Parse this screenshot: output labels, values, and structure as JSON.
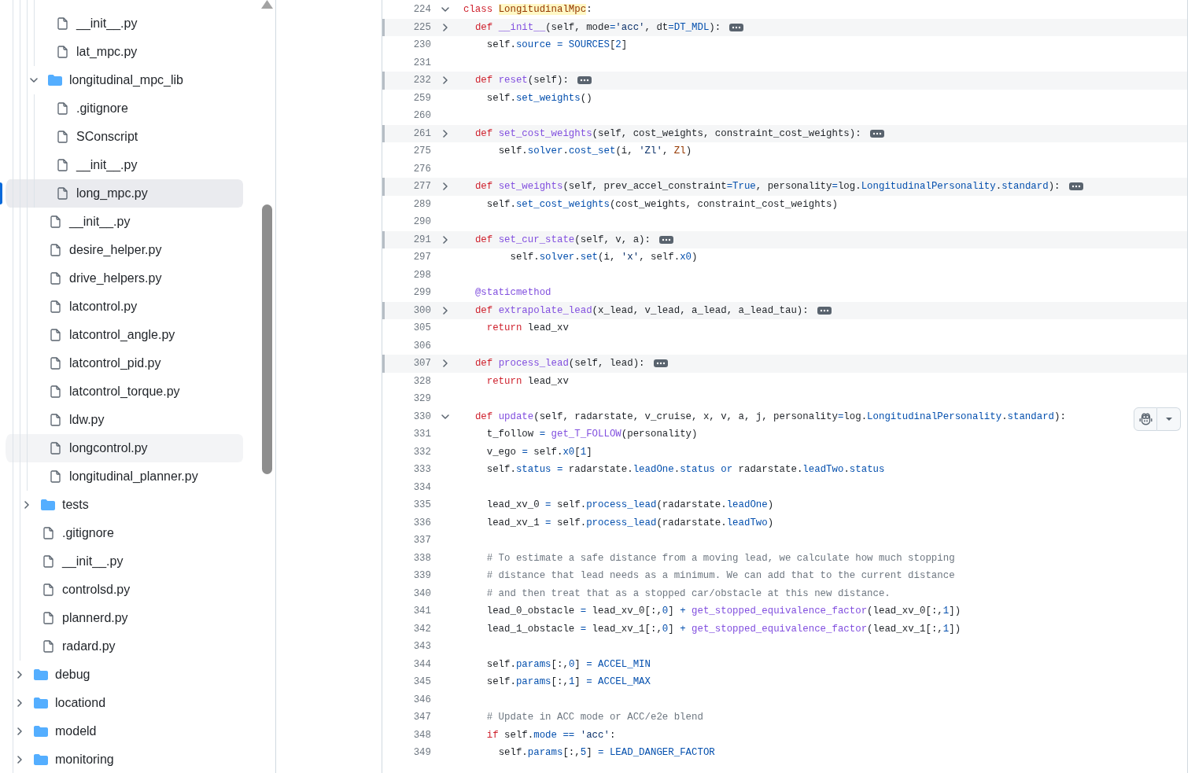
{
  "file_tree": {
    "items": [
      {
        "children": [
          {
            "children": [
              {
                "children": [
                  {
                    "kind": "file",
                    "name": "__init__.py",
                    "selected": false,
                    "hovered": false
                  },
                  {
                    "kind": "file",
                    "name": "lat_mpc.py",
                    "selected": false,
                    "hovered": false
                  }
                ]
              },
              {
                "kind": "folder",
                "name": "longitudinal_mpc_lib",
                "expanded": true,
                "selected": false,
                "hovered": false,
                "children": [
                  {
                    "kind": "file",
                    "name": ".gitignore",
                    "selected": false,
                    "hovered": false
                  },
                  {
                    "kind": "file",
                    "name": "SConscript",
                    "selected": false,
                    "hovered": false
                  },
                  {
                    "kind": "file",
                    "name": "__init__.py",
                    "selected": false,
                    "hovered": false
                  },
                  {
                    "kind": "file",
                    "name": "long_mpc.py",
                    "selected": true,
                    "hovered": false
                  }
                ]
              },
              {
                "kind": "file",
                "name": "__init__.py",
                "selected": false,
                "hovered": false
              },
              {
                "kind": "file",
                "name": "desire_helper.py",
                "selected": false,
                "hovered": false
              },
              {
                "kind": "file",
                "name": "drive_helpers.py",
                "selected": false,
                "hovered": false
              },
              {
                "kind": "file",
                "name": "latcontrol.py",
                "selected": false,
                "hovered": false
              },
              {
                "kind": "file",
                "name": "latcontrol_angle.py",
                "selected": false,
                "hovered": false
              },
              {
                "kind": "file",
                "name": "latcontrol_pid.py",
                "selected": false,
                "hovered": false
              },
              {
                "kind": "file",
                "name": "latcontrol_torque.py",
                "selected": false,
                "hovered": false
              },
              {
                "kind": "file",
                "name": "ldw.py",
                "selected": false,
                "hovered": false
              },
              {
                "kind": "file",
                "name": "longcontrol.py",
                "selected": false,
                "hovered": true
              },
              {
                "kind": "file",
                "name": "longitudinal_planner.py",
                "selected": false,
                "hovered": false
              }
            ]
          },
          {
            "kind": "folder",
            "name": "tests",
            "expanded": false,
            "selected": false,
            "hovered": false
          },
          {
            "kind": "file",
            "name": ".gitignore",
            "selected": false,
            "hovered": false
          },
          {
            "kind": "file",
            "name": "__init__.py",
            "selected": false,
            "hovered": false
          },
          {
            "kind": "file",
            "name": "controlsd.py",
            "selected": false,
            "hovered": false
          },
          {
            "kind": "file",
            "name": "plannerd.py",
            "selected": false,
            "hovered": false
          },
          {
            "kind": "file",
            "name": "radard.py",
            "selected": false,
            "hovered": false
          }
        ]
      },
      {
        "kind": "folder",
        "name": "debug",
        "expanded": false,
        "selected": false,
        "hovered": false
      },
      {
        "kind": "folder",
        "name": "locationd",
        "expanded": false,
        "selected": false,
        "hovered": false
      },
      {
        "kind": "folder",
        "name": "modeld",
        "expanded": false,
        "selected": false,
        "hovered": false
      },
      {
        "kind": "folder",
        "name": "monitoring",
        "expanded": false,
        "selected": false,
        "hovered": false
      }
    ]
  },
  "code_view": {
    "lines": [
      {
        "number": "224",
        "kind": "fold",
        "expanded": true,
        "tokens": [
          {
            "text": "class ",
            "kind": "keyword"
          },
          {
            "text": "LongitudinalMpc",
            "kind": "match"
          },
          {
            "text": ":",
            "kind": "plain"
          }
        ]
      },
      {
        "number": "225",
        "kind": "fold",
        "expanded": false,
        "tokens": [
          {
            "text": "  def ",
            "kind": "keyword"
          },
          {
            "text": "__init__",
            "kind": "function"
          },
          {
            "text": "(self, mode",
            "kind": "plain"
          },
          {
            "text": "=",
            "kind": "constant"
          },
          {
            "text": "'acc'",
            "kind": "string"
          },
          {
            "text": ", dt",
            "kind": "plain"
          },
          {
            "text": "=DT_MDL",
            "kind": "constant"
          },
          {
            "text": "):",
            "kind": "plain"
          }
        ]
      },
      {
        "number": "230",
        "kind": "code",
        "tokens": [
          {
            "text": "    self.",
            "kind": "plain"
          },
          {
            "text": "source = SOURCES",
            "kind": "constant"
          },
          {
            "text": "[",
            "kind": "plain"
          },
          {
            "text": "2",
            "kind": "constant"
          },
          {
            "text": "]",
            "kind": "plain"
          }
        ]
      },
      {
        "number": "231",
        "kind": "code"
      },
      {
        "number": "232",
        "kind": "fold",
        "expanded": false,
        "tokens": [
          {
            "text": "  def ",
            "kind": "keyword"
          },
          {
            "text": "reset",
            "kind": "function"
          },
          {
            "text": "(self):",
            "kind": "plain"
          }
        ]
      },
      {
        "number": "259",
        "kind": "code",
        "tokens": [
          {
            "text": "    self.",
            "kind": "plain"
          },
          {
            "text": "set_weights",
            "kind": "constant"
          },
          {
            "text": "()",
            "kind": "plain"
          }
        ]
      },
      {
        "number": "260",
        "kind": "code"
      },
      {
        "number": "261",
        "kind": "fold",
        "expanded": false,
        "tokens": [
          {
            "text": "  def ",
            "kind": "keyword"
          },
          {
            "text": "set_cost_weights",
            "kind": "function"
          },
          {
            "text": "(self, cost_weights, constraint_cost_weights):",
            "kind": "plain"
          }
        ]
      },
      {
        "number": "275",
        "kind": "code",
        "tokens": [
          {
            "text": "      self.",
            "kind": "plain"
          },
          {
            "text": "solver",
            "kind": "constant"
          },
          {
            "text": ".",
            "kind": "plain"
          },
          {
            "text": "cost_set",
            "kind": "constant"
          },
          {
            "text": "(i, ",
            "kind": "plain"
          },
          {
            "text": "'Zl'",
            "kind": "string"
          },
          {
            "text": ", ",
            "kind": "plain"
          },
          {
            "text": "Zl",
            "kind": "variable"
          },
          {
            "text": ")",
            "kind": "plain"
          }
        ]
      },
      {
        "number": "276",
        "kind": "code"
      },
      {
        "number": "277",
        "kind": "fold",
        "expanded": false,
        "tokens": [
          {
            "text": "  def ",
            "kind": "keyword"
          },
          {
            "text": "set_weights",
            "kind": "function"
          },
          {
            "text": "(self, prev_accel_constraint",
            "kind": "plain"
          },
          {
            "text": "=True",
            "kind": "constant"
          },
          {
            "text": ", personality",
            "kind": "plain"
          },
          {
            "text": "=",
            "kind": "constant"
          },
          {
            "text": "log.",
            "kind": "plain"
          },
          {
            "text": "LongitudinalPersonality",
            "kind": "constant"
          },
          {
            "text": ".",
            "kind": "plain"
          },
          {
            "text": "standard",
            "kind": "constant"
          },
          {
            "text": "):",
            "kind": "plain"
          }
        ]
      },
      {
        "number": "289",
        "kind": "code",
        "tokens": [
          {
            "text": "    self.",
            "kind": "plain"
          },
          {
            "text": "set_cost_weights",
            "kind": "constant"
          },
          {
            "text": "(cost_weights, constraint_cost_weights)",
            "kind": "plain"
          }
        ]
      },
      {
        "number": "290",
        "kind": "code"
      },
      {
        "number": "291",
        "kind": "fold",
        "expanded": false,
        "tokens": [
          {
            "text": "  def ",
            "kind": "keyword"
          },
          {
            "text": "set_cur_state",
            "kind": "function"
          },
          {
            "text": "(self, v, a):",
            "kind": "plain"
          }
        ]
      },
      {
        "number": "297",
        "kind": "code",
        "tokens": [
          {
            "text": "        self.",
            "kind": "plain"
          },
          {
            "text": "solver",
            "kind": "constant"
          },
          {
            "text": ".",
            "kind": "plain"
          },
          {
            "text": "set",
            "kind": "constant"
          },
          {
            "text": "(i, ",
            "kind": "plain"
          },
          {
            "text": "'x'",
            "kind": "string"
          },
          {
            "text": ", self.",
            "kind": "plain"
          },
          {
            "text": "x0",
            "kind": "constant"
          },
          {
            "text": ")",
            "kind": "plain"
          }
        ]
      },
      {
        "number": "298",
        "kind": "code"
      },
      {
        "number": "299",
        "kind": "code",
        "tokens": [
          {
            "text": "  @staticmethod",
            "kind": "function"
          }
        ]
      },
      {
        "number": "300",
        "kind": "fold",
        "expanded": false,
        "tokens": [
          {
            "text": "  def ",
            "kind": "keyword"
          },
          {
            "text": "extrapolate_lead",
            "kind": "function"
          },
          {
            "text": "(x_lead, v_lead, a_lead, a_lead_tau):",
            "kind": "plain"
          }
        ]
      },
      {
        "number": "305",
        "kind": "code",
        "tokens": [
          {
            "text": "    return",
            "kind": "keyword"
          },
          {
            "text": " lead_xv",
            "kind": "plain"
          }
        ]
      },
      {
        "number": "306",
        "kind": "code"
      },
      {
        "number": "307",
        "kind": "fold",
        "expanded": false,
        "tokens": [
          {
            "text": "  def ",
            "kind": "keyword"
          },
          {
            "text": "process_lead",
            "kind": "function"
          },
          {
            "text": "(self, lead):",
            "kind": "plain"
          }
        ]
      },
      {
        "number": "328",
        "kind": "code",
        "tokens": [
          {
            "text": "    return",
            "kind": "keyword"
          },
          {
            "text": " lead_xv",
            "kind": "plain"
          }
        ]
      },
      {
        "number": "329",
        "kind": "code"
      },
      {
        "number": "330",
        "kind": "fold",
        "expanded": true,
        "tokens": [
          {
            "text": "  def ",
            "kind": "keyword"
          },
          {
            "text": "update",
            "kind": "function"
          },
          {
            "text": "(self, radarstate, v_cruise, x, v, a, j, personality",
            "kind": "plain"
          },
          {
            "text": "=",
            "kind": "constant"
          },
          {
            "text": "log.",
            "kind": "plain"
          },
          {
            "text": "LongitudinalPersonality",
            "kind": "constant"
          },
          {
            "text": ".",
            "kind": "plain"
          },
          {
            "text": "standard",
            "kind": "constant"
          },
          {
            "text": "):",
            "kind": "plain"
          }
        ]
      },
      {
        "number": "331",
        "kind": "code",
        "tokens": [
          {
            "text": "    t_follow ",
            "kind": "plain"
          },
          {
            "text": "= ",
            "kind": "constant"
          },
          {
            "text": "get_T_FOLLOW",
            "kind": "function"
          },
          {
            "text": "(personality)",
            "kind": "plain"
          }
        ]
      },
      {
        "number": "332",
        "kind": "code",
        "tokens": [
          {
            "text": "    v_ego ",
            "kind": "plain"
          },
          {
            "text": "=",
            "kind": "constant"
          },
          {
            "text": " self.",
            "kind": "plain"
          },
          {
            "text": "x0",
            "kind": "constant"
          },
          {
            "text": "[",
            "kind": "plain"
          },
          {
            "text": "1",
            "kind": "constant"
          },
          {
            "text": "]",
            "kind": "plain"
          }
        ]
      },
      {
        "number": "333",
        "kind": "code",
        "tokens": [
          {
            "text": "    self.",
            "kind": "plain"
          },
          {
            "text": "status =",
            "kind": "constant"
          },
          {
            "text": " radarstate.",
            "kind": "plain"
          },
          {
            "text": "leadOne",
            "kind": "constant"
          },
          {
            "text": ".",
            "kind": "plain"
          },
          {
            "text": "status or",
            "kind": "constant"
          },
          {
            "text": " radarstate.",
            "kind": "plain"
          },
          {
            "text": "leadTwo",
            "kind": "constant"
          },
          {
            "text": ".",
            "kind": "plain"
          },
          {
            "text": "status",
            "kind": "constant"
          }
        ]
      },
      {
        "number": "334",
        "kind": "code"
      },
      {
        "number": "335",
        "kind": "code",
        "tokens": [
          {
            "text": "    lead_xv_0 ",
            "kind": "plain"
          },
          {
            "text": "=",
            "kind": "constant"
          },
          {
            "text": " self.",
            "kind": "plain"
          },
          {
            "text": "process_lead",
            "kind": "constant"
          },
          {
            "text": "(radarstate.",
            "kind": "plain"
          },
          {
            "text": "leadOne",
            "kind": "constant"
          },
          {
            "text": ")",
            "kind": "plain"
          }
        ]
      },
      {
        "number": "336",
        "kind": "code",
        "tokens": [
          {
            "text": "    lead_xv_1 ",
            "kind": "plain"
          },
          {
            "text": "=",
            "kind": "constant"
          },
          {
            "text": " self.",
            "kind": "plain"
          },
          {
            "text": "process_lead",
            "kind": "constant"
          },
          {
            "text": "(radarstate.",
            "kind": "plain"
          },
          {
            "text": "leadTwo",
            "kind": "constant"
          },
          {
            "text": ")",
            "kind": "plain"
          }
        ]
      },
      {
        "number": "337",
        "kind": "code"
      },
      {
        "number": "338",
        "kind": "code",
        "tokens": [
          {
            "text": "    # To estimate a safe distance from a moving lead, we calculate how much stopping",
            "kind": "comment"
          }
        ]
      },
      {
        "number": "339",
        "kind": "code",
        "tokens": [
          {
            "text": "    # distance that lead needs as a minimum. We can add that to the current distance",
            "kind": "comment"
          }
        ]
      },
      {
        "number": "340",
        "kind": "code",
        "tokens": [
          {
            "text": "    # and then treat that as a stopped car/obstacle at this new distance.",
            "kind": "comment"
          }
        ]
      },
      {
        "number": "341",
        "kind": "code",
        "tokens": [
          {
            "text": "    lead_0_obstacle ",
            "kind": "plain"
          },
          {
            "text": "=",
            "kind": "constant"
          },
          {
            "text": " lead_xv_0[:,",
            "kind": "plain"
          },
          {
            "text": "0",
            "kind": "constant"
          },
          {
            "text": "] ",
            "kind": "plain"
          },
          {
            "text": "+ ",
            "kind": "constant"
          },
          {
            "text": "get_stopped_equivalence_factor",
            "kind": "function"
          },
          {
            "text": "(lead_xv_0[:,",
            "kind": "plain"
          },
          {
            "text": "1",
            "kind": "constant"
          },
          {
            "text": "])",
            "kind": "plain"
          }
        ]
      },
      {
        "number": "342",
        "kind": "code",
        "tokens": [
          {
            "text": "    lead_1_obstacle ",
            "kind": "plain"
          },
          {
            "text": "=",
            "kind": "constant"
          },
          {
            "text": " lead_xv_1[:,",
            "kind": "plain"
          },
          {
            "text": "0",
            "kind": "constant"
          },
          {
            "text": "] ",
            "kind": "plain"
          },
          {
            "text": "+ ",
            "kind": "constant"
          },
          {
            "text": "get_stopped_equivalence_factor",
            "kind": "function"
          },
          {
            "text": "(lead_xv_1[:,",
            "kind": "plain"
          },
          {
            "text": "1",
            "kind": "constant"
          },
          {
            "text": "])",
            "kind": "plain"
          }
        ]
      },
      {
        "number": "343",
        "kind": "code"
      },
      {
        "number": "344",
        "kind": "code",
        "tokens": [
          {
            "text": "    self.",
            "kind": "plain"
          },
          {
            "text": "params",
            "kind": "constant"
          },
          {
            "text": "[:,",
            "kind": "plain"
          },
          {
            "text": "0",
            "kind": "constant"
          },
          {
            "text": "] ",
            "kind": "plain"
          },
          {
            "text": "= ACCEL_MIN",
            "kind": "constant"
          }
        ]
      },
      {
        "number": "345",
        "kind": "code",
        "tokens": [
          {
            "text": "    self.",
            "kind": "plain"
          },
          {
            "text": "params",
            "kind": "constant"
          },
          {
            "text": "[:,",
            "kind": "plain"
          },
          {
            "text": "1",
            "kind": "constant"
          },
          {
            "text": "] ",
            "kind": "plain"
          },
          {
            "text": "= ACCEL_MAX",
            "kind": "constant"
          }
        ]
      },
      {
        "number": "346",
        "kind": "code"
      },
      {
        "number": "347",
        "kind": "code",
        "tokens": [
          {
            "text": "    # Update in ACC mode or ACC/e2e blend",
            "kind": "comment"
          }
        ]
      },
      {
        "number": "348",
        "kind": "code",
        "tokens": [
          {
            "text": "    if",
            "kind": "keyword"
          },
          {
            "text": " self.",
            "kind": "plain"
          },
          {
            "text": "mode ==",
            "kind": "constant"
          },
          {
            "text": " 'acc'",
            "kind": "string"
          },
          {
            "text": ":",
            "kind": "plain"
          }
        ]
      },
      {
        "number": "349",
        "kind": "code",
        "tokens": [
          {
            "text": "      self.",
            "kind": "plain"
          },
          {
            "text": "params",
            "kind": "constant"
          },
          {
            "text": "[:,",
            "kind": "plain"
          },
          {
            "text": "5",
            "kind": "constant"
          },
          {
            "text": "] ",
            "kind": "plain"
          },
          {
            "text": "= LEAD_DANGER_FACTOR",
            "kind": "constant"
          }
        ]
      }
    ]
  }
}
